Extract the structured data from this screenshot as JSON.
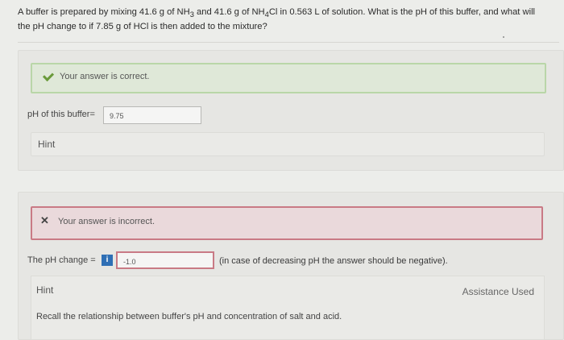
{
  "question": {
    "text_before": "A buffer is prepared by mixing 41.6 g of NH",
    "sub1": "3",
    "text_mid": " and 41.6 g of NH",
    "sub2": "4",
    "text_after": "Cl in 0.563 L of solution. What is the pH of this buffer, and what will the pH change to if 7.85 g of HCl is then added to the mixture?"
  },
  "part1": {
    "status_text": "Your answer is correct.",
    "label": "pH of this buffer=",
    "value": "9.75",
    "hint": "Hint"
  },
  "part2": {
    "status_text": "Your answer is incorrect.",
    "label": "The pH change =",
    "info_icon": "i",
    "value": "-1.0",
    "note": "(in case of decreasing pH the answer should be negative).",
    "hint": "Hint",
    "assistance": "Assistance Used",
    "recall": "Recall the relationship between buffer's pH and concentration of salt and acid."
  },
  "colors": {
    "correct_border": "#b9d6a8",
    "incorrect_border": "#c97a85",
    "info_blue": "#2f6fb5"
  },
  "icons": {
    "check": "check-icon",
    "cross": "x-icon",
    "info": "info-icon"
  }
}
